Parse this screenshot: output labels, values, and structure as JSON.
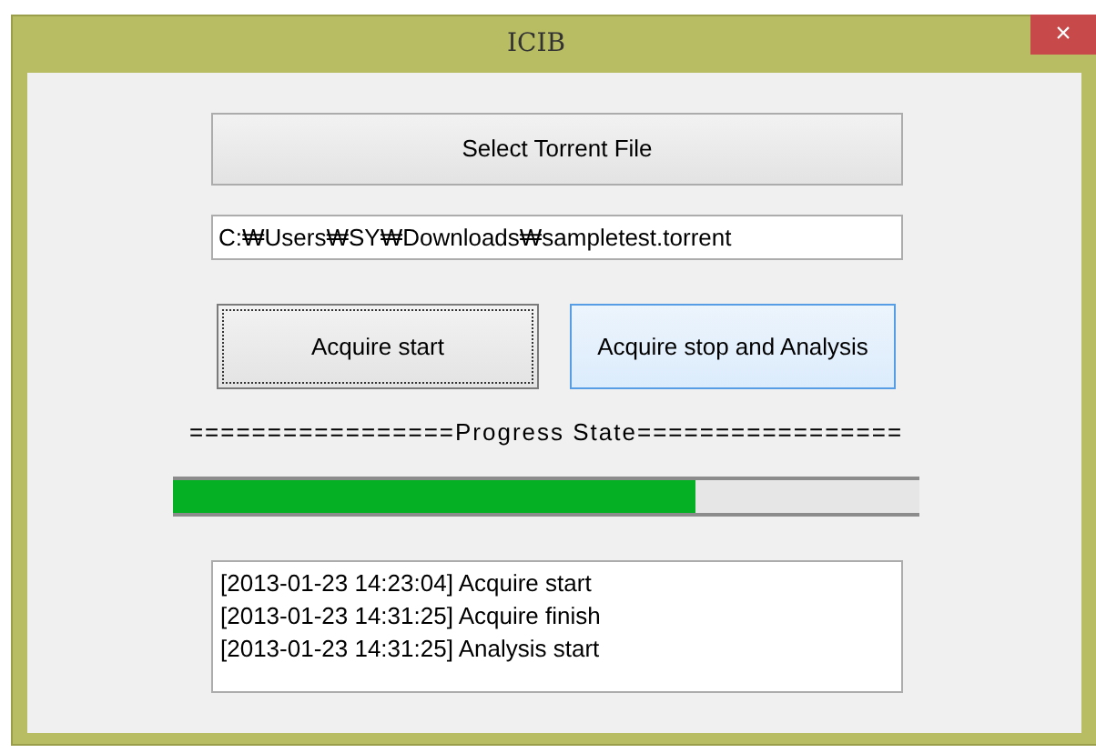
{
  "window": {
    "title": "ICIB",
    "close": "×"
  },
  "select_button": {
    "label": "Select Torrent File"
  },
  "path_field": {
    "value": "C:₩Users₩SY₩Downloads₩sampletest.torrent"
  },
  "action_buttons": [
    {
      "label": "Acquire start",
      "focused": true,
      "hovered": false
    },
    {
      "label": "Acquire stop and Analysis",
      "focused": false,
      "hovered": true
    }
  ],
  "progress": {
    "label": "=================Progress State=================",
    "level": 0.7
  },
  "log": [
    "[2013-01-23 14:23:04] Acquire start",
    "[2013-01-23 14:31:25] Acquire finish",
    "[2013-01-23 14:31:25] Analysis start"
  ]
}
